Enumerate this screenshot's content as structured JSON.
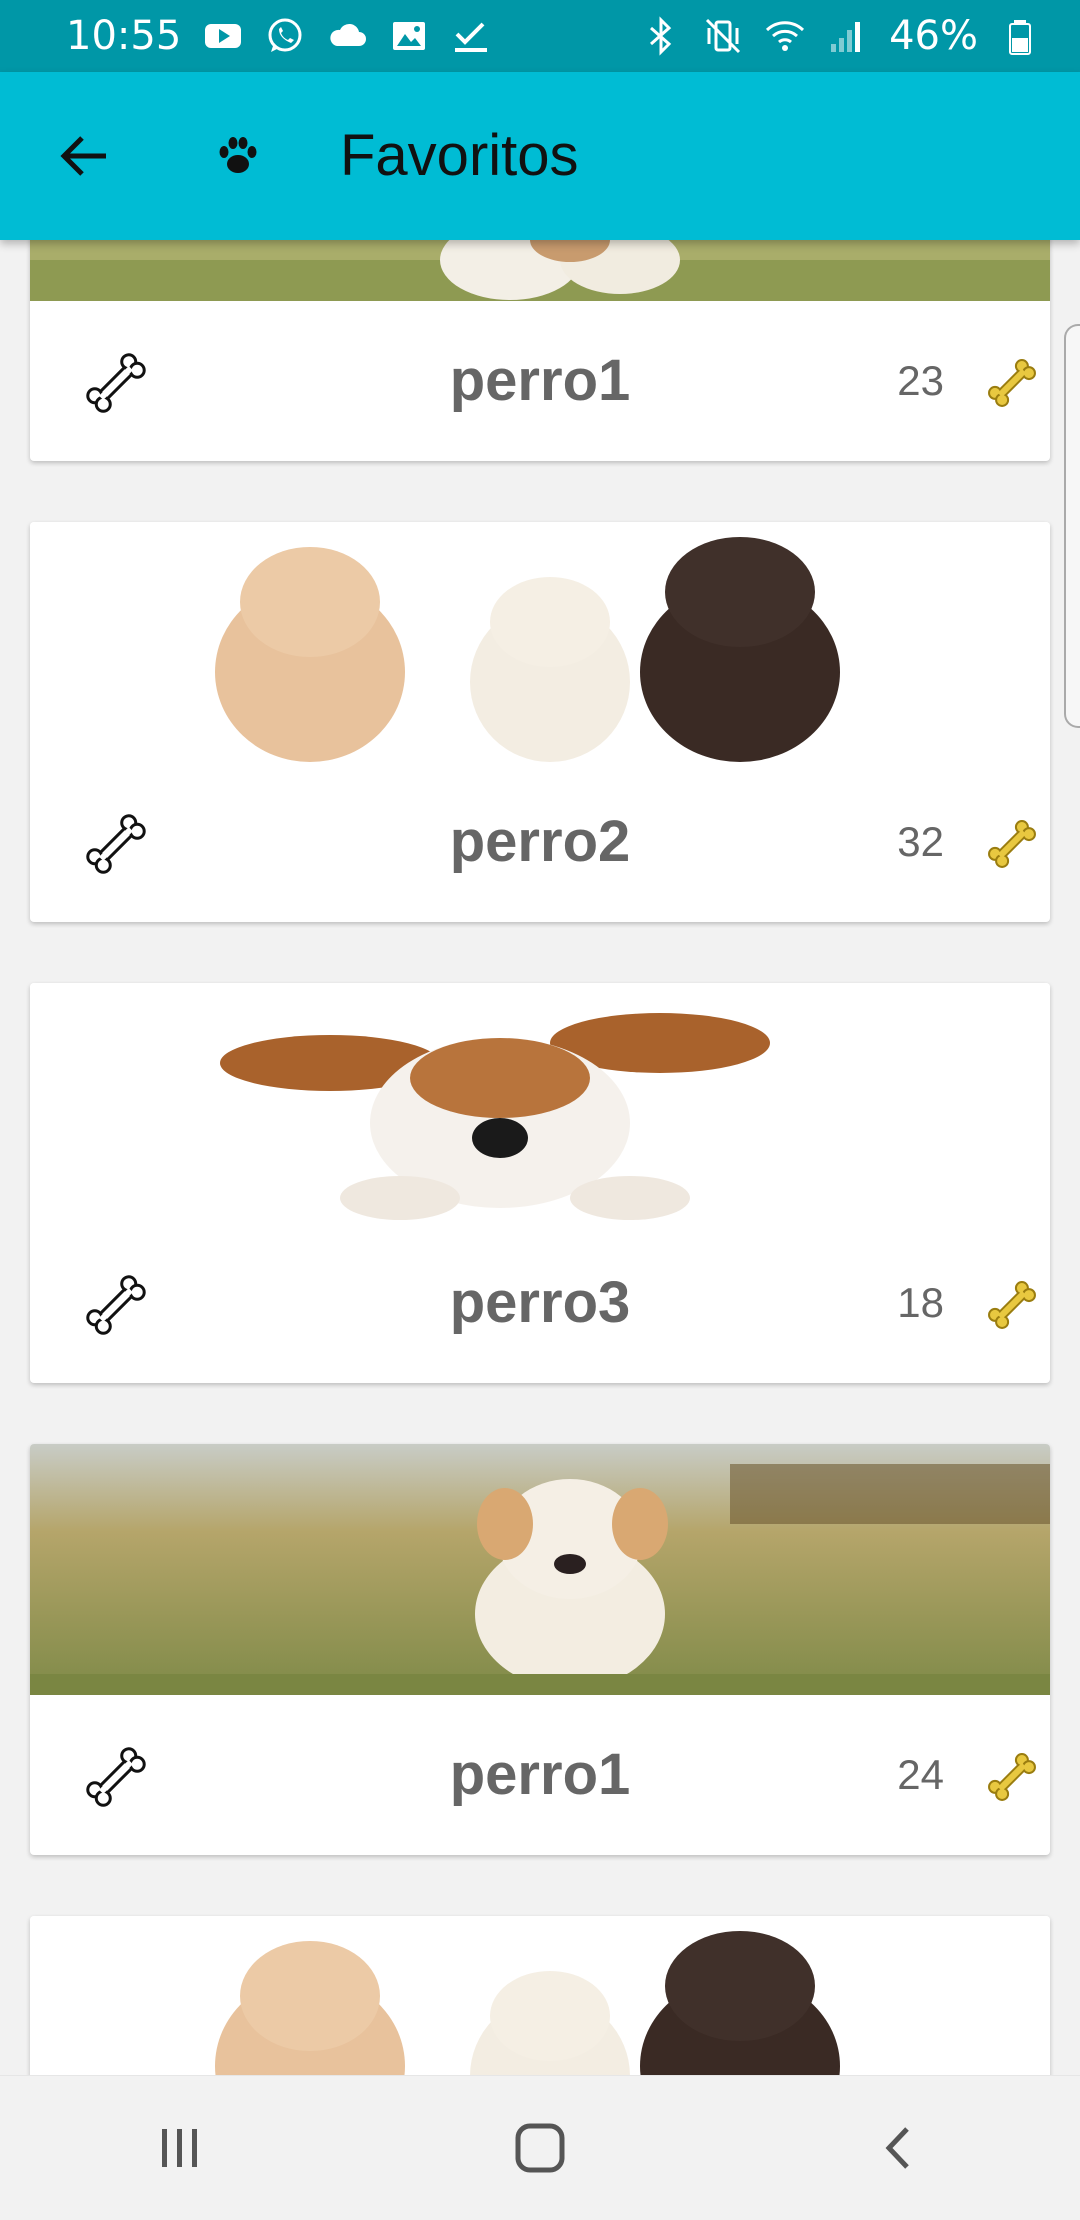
{
  "status_bar": {
    "time": "10:55",
    "battery": "46%",
    "left_icons": [
      "youtube-icon",
      "whatsapp-icon",
      "cloud-icon",
      "image-icon",
      "checkbox-icon"
    ],
    "right_icons": [
      "bluetooth-icon",
      "vibrate-icon",
      "wifi-icon",
      "signal-icon",
      "battery-icon"
    ]
  },
  "app_bar": {
    "title": "Favoritos",
    "back_icon": "arrow-back-icon",
    "logo_icon": "paw-icon"
  },
  "cards": [
    {
      "name": "perro1",
      "likes": "23",
      "photo": "puppy-running-grass"
    },
    {
      "name": "perro2",
      "likes": "32",
      "photo": "three-puppies"
    },
    {
      "name": "perro3",
      "likes": "18",
      "photo": "puppy-big-ears"
    },
    {
      "name": "perro1",
      "likes": "24",
      "photo": "puppy-running-grass"
    },
    {
      "name": "",
      "likes": "",
      "photo": "three-puppies"
    }
  ],
  "nav_bar": {
    "icons": [
      "recents-icon",
      "home-icon",
      "back-icon"
    ]
  },
  "colors": {
    "status_bar": "#0097a7",
    "app_bar": "#00bcd4",
    "bone_gold": "#e8c840",
    "text_gray": "#666666"
  }
}
